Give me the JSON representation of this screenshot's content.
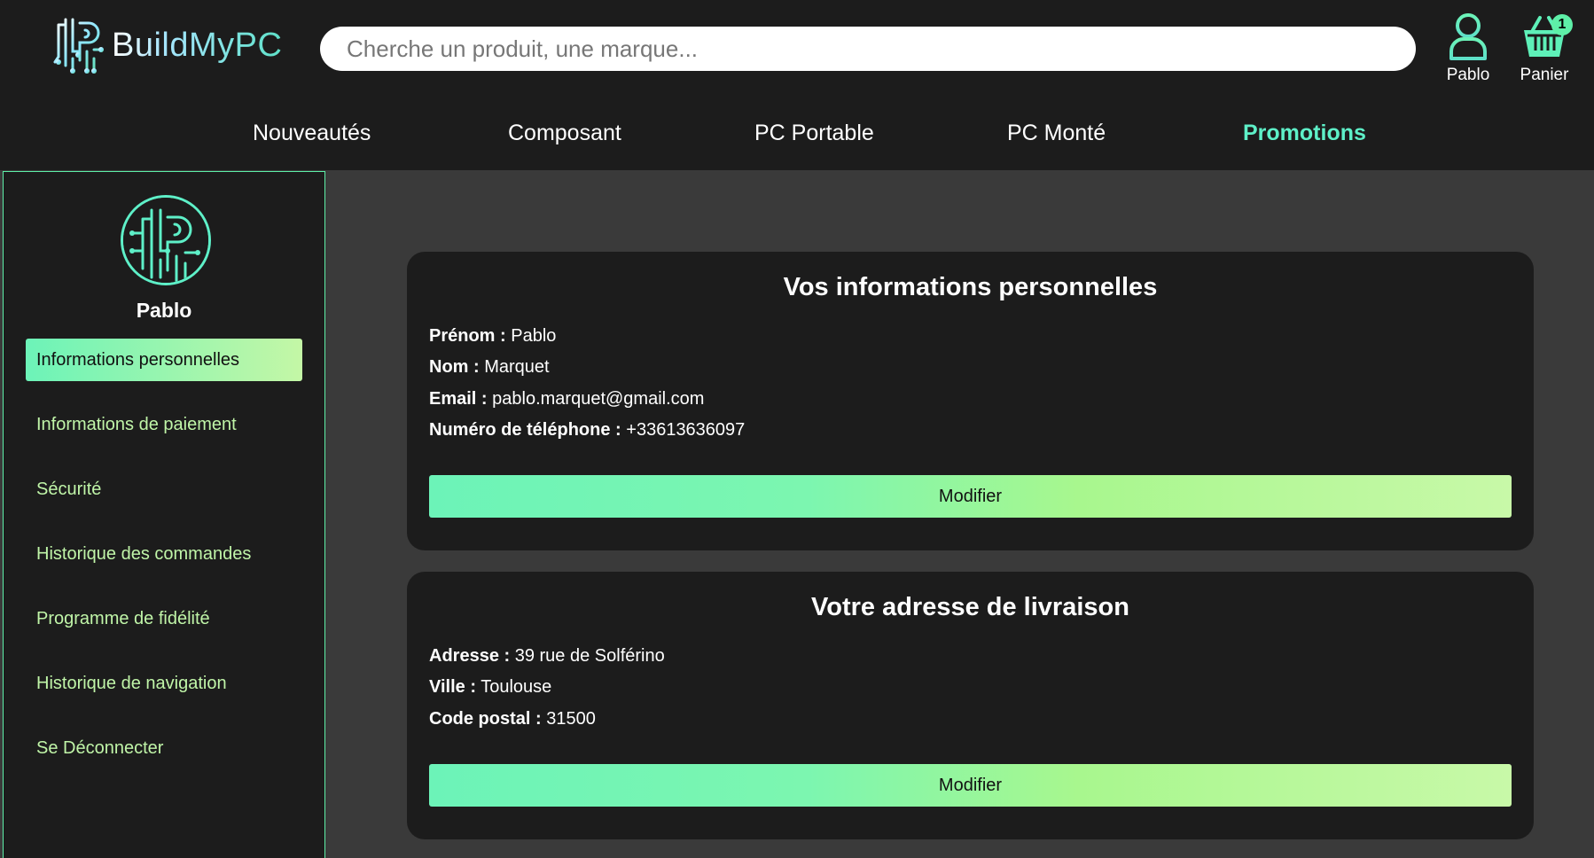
{
  "brand": {
    "name": "BuildMyPC",
    "accent": "#5ef0c8",
    "accent_green": "#5ef0a8"
  },
  "search": {
    "placeholder": "Cherche un produit, une marque..."
  },
  "header": {
    "user_label": "Pablo",
    "cart_label": "Panier",
    "cart_count": "1"
  },
  "nav": {
    "items": [
      {
        "label": "Nouveautés"
      },
      {
        "label": "Composant"
      },
      {
        "label": "PC Portable"
      },
      {
        "label": "PC Monté"
      },
      {
        "label": "Promotions"
      }
    ]
  },
  "sidebar": {
    "user_name": "Pablo",
    "items": [
      {
        "label": "Informations personnelles"
      },
      {
        "label": "Informations de paiement"
      },
      {
        "label": "Sécurité"
      },
      {
        "label": "Historique des commandes"
      },
      {
        "label": "Programme de fidélité"
      },
      {
        "label": "Historique de navigation"
      },
      {
        "label": "Se Déconnecter"
      }
    ]
  },
  "personal": {
    "title": "Vos informations personnelles",
    "firstname_label": "Prénom :",
    "firstname": "Pablo",
    "lastname_label": "Nom :",
    "lastname": "Marquet",
    "email_label": "Email :",
    "email": "pablo.marquet@gmail.com",
    "phone_label": "Numéro de téléphone :",
    "phone": "+33613636097",
    "button": "Modifier"
  },
  "delivery": {
    "title": "Votre adresse de livraison",
    "address_label": "Adresse :",
    "address": "39 rue de Solférino",
    "city_label": "Ville :",
    "city": "Toulouse",
    "zip_label": "Code postal :",
    "zip": "31500",
    "button": "Modifier"
  }
}
